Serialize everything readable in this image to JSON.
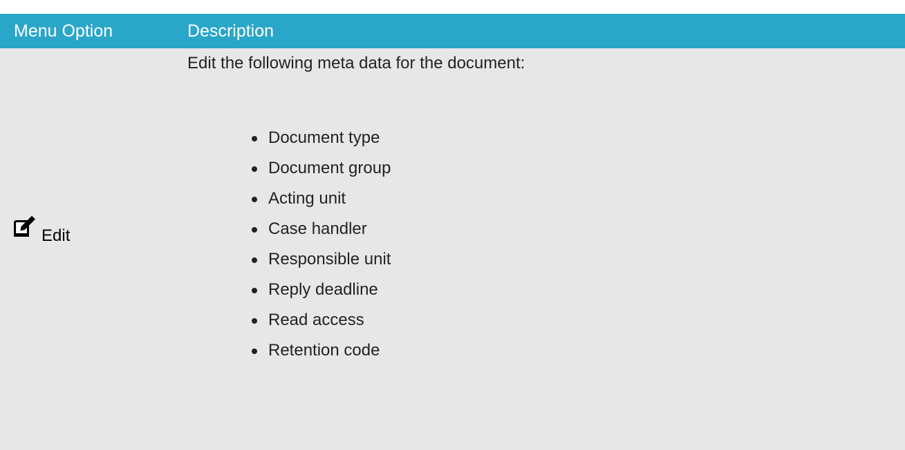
{
  "table": {
    "headers": {
      "menu_option": "Menu Option",
      "description": "Description"
    },
    "rows": [
      {
        "menu_option": {
          "icon": "edit-icon",
          "label": "Edit"
        },
        "description": {
          "intro": "Edit the following meta data for the document:",
          "items": [
            "Document type",
            "Document group",
            "Acting unit",
            "Case handler",
            "Responsible unit",
            "Reply deadline",
            "Read access",
            "Retention code"
          ]
        }
      }
    ]
  },
  "colors": {
    "header_background": "#2aa6c9",
    "header_text": "#ffffff",
    "row_background": "#e7e7e7",
    "text": "#222222"
  }
}
